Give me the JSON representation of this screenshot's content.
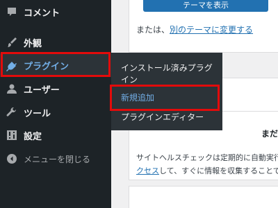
{
  "sidebar": {
    "items": [
      {
        "label": "コメント",
        "icon": "comment-icon"
      },
      {
        "label": "外観",
        "icon": "appearance-brush-icon"
      },
      {
        "label": "プラグイン",
        "icon": "plugin-icon",
        "current": true
      },
      {
        "label": "ユーザー",
        "icon": "user-icon"
      },
      {
        "label": "ツール",
        "icon": "wrench-icon"
      },
      {
        "label": "設定",
        "icon": "settings-icon"
      },
      {
        "label": "メニューを閉じる",
        "icon": "collapse-arrow-icon"
      }
    ]
  },
  "submenu": {
    "installed": "インストール済みプラグイン",
    "add_new": "新規追加",
    "editor": "プラグインエディター"
  },
  "main": {
    "theme_button": "テーマを表示",
    "theme_prefix": "または、",
    "theme_link": "別のテーマに変更する",
    "health_heading": "まだ",
    "health_line1": "サイトヘルスチェックは定期的に自動実行",
    "health_link": "クセス",
    "health_line2": "して、すぐに情報を収集することで"
  },
  "colors": {
    "sidebar_bg": "#1d2327",
    "submenu_bg": "#2c3338",
    "accent_blue": "#72aee6",
    "link_blue": "#2271b1",
    "highlight_red": "#e30b0b"
  }
}
